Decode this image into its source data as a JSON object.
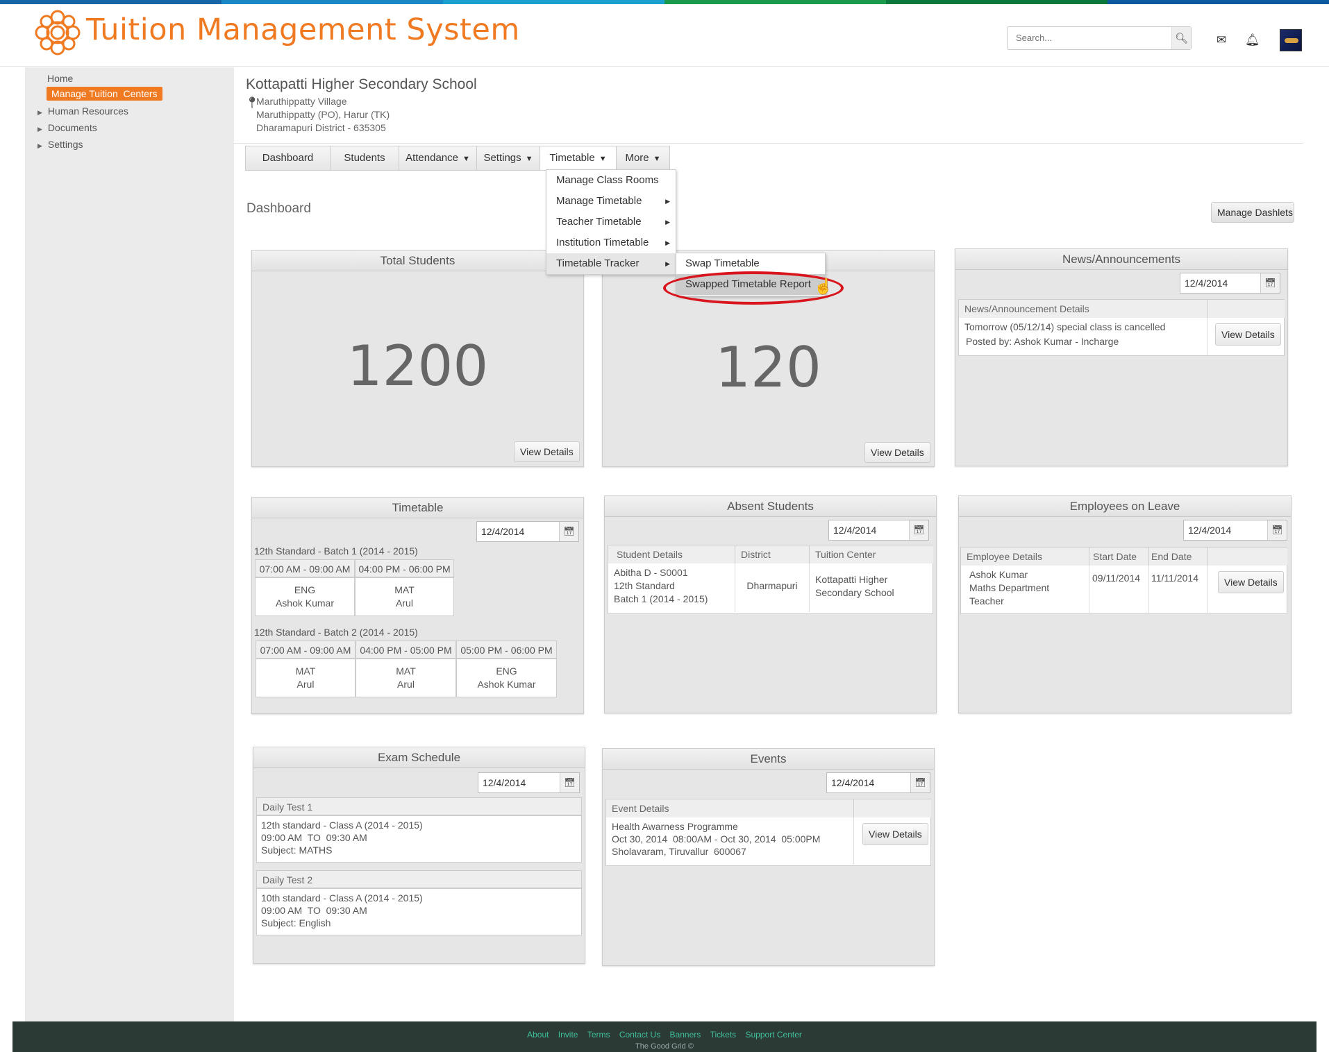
{
  "app": {
    "title": "Tuition Management System"
  },
  "header": {
    "search_placeholder": "Search...",
    "colors": [
      "#1565a8",
      "#1a87c7",
      "#1ba1d1",
      "#1b9a4b",
      "#0a7a3c",
      "#0e5aa0"
    ]
  },
  "sidebar": {
    "items": [
      {
        "label": "Home",
        "active": false,
        "expandable": false
      },
      {
        "label": "Manage Tuition  Centers",
        "active": true,
        "expandable": false
      },
      {
        "label": "Human Resources",
        "active": false,
        "expandable": true
      },
      {
        "label": "Documents",
        "active": false,
        "expandable": true
      },
      {
        "label": "Settings",
        "active": false,
        "expandable": true
      }
    ]
  },
  "school": {
    "name": "Kottapatti Higher Secondary School",
    "address": [
      "Maruthippatty Village",
      "Maruthippatty (PO), Harur (TK)",
      "Dharamapuri District - 635305"
    ]
  },
  "tabs": [
    "Dashboard",
    "Students",
    "Attendance",
    "Settings",
    "Timetable",
    "More"
  ],
  "timetable_menu": {
    "items": [
      "Manage Class Rooms",
      "Manage Timetable",
      "Teacher Timetable",
      "Institution Timetable",
      "Timetable Tracker"
    ],
    "submenu": [
      "Swap Timetable",
      "Swapped Timetable Report"
    ]
  },
  "dashboard": {
    "label": "Dashboard",
    "manage_dashlets": "Manage Dashlets",
    "total_students": {
      "title": "Total Students",
      "value": "1200",
      "button": "View Details"
    },
    "second_stat": {
      "value": "120",
      "button": "View Details"
    },
    "news": {
      "title": "News/Announcements",
      "date": "12/4/2014",
      "header": "News/Announcement Details",
      "text": "Tomorrow (05/12/14) special class is cancelled",
      "posted": "Posted by: Ashok Kumar - Incharge",
      "button": "View Details"
    },
    "timetable": {
      "title": "Timetable",
      "date": "12/4/2014",
      "batch1": {
        "label": "12th Standard - Batch 1 (2014 - 2015)",
        "slots": [
          "07:00 AM - 09:00 AM",
          "04:00 PM - 06:00 PM"
        ],
        "subjects": [
          [
            "ENG",
            "Ashok Kumar"
          ],
          [
            "MAT",
            "Arul"
          ]
        ]
      },
      "batch2": {
        "label": "12th Standard - Batch 2 (2014 - 2015)",
        "slots": [
          "07:00 AM - 09:00 AM",
          "04:00 PM - 05:00 PM",
          "05:00 PM - 06:00 PM"
        ],
        "subjects": [
          [
            "MAT",
            "Arul"
          ],
          [
            "MAT",
            "Arul"
          ],
          [
            "ENG",
            "Ashok Kumar"
          ]
        ]
      }
    },
    "absent": {
      "title": "Absent Students",
      "date": "12/4/2014",
      "headers": [
        "Student Details",
        "District",
        "Tuition Center"
      ],
      "row": {
        "student": [
          "Abitha D - S0001",
          "12th Standard",
          "Batch 1 (2014 - 2015)"
        ],
        "district": "Dharmapuri",
        "center": [
          "Kottapatti Higher",
          "Secondary School"
        ]
      }
    },
    "leave": {
      "title": "Employees on Leave",
      "date": "12/4/2014",
      "headers": [
        "Employee Details",
        "Start Date",
        "End Date"
      ],
      "row": {
        "employee": [
          "Ashok Kumar",
          "Maths Department",
          "Teacher"
        ],
        "start": "09/11/2014",
        "end": "11/11/2014"
      },
      "button": "View Details"
    },
    "exam": {
      "title": "Exam Schedule",
      "date": "12/4/2014",
      "tests": [
        {
          "name": "Daily Test 1",
          "lines": [
            "12th standard - Class A (2014 - 2015)",
            "09:00 AM  TO  09:30 AM",
            "Subject: MATHS"
          ]
        },
        {
          "name": "Daily Test 2",
          "lines": [
            "10th standard - Class A (2014 - 2015)",
            "09:00 AM  TO  09:30 AM",
            "Subject: English"
          ]
        }
      ]
    },
    "events": {
      "title": "Events",
      "date": "12/4/2014",
      "header": "Event Details",
      "lines": [
        "Health Awarness Programme",
        "Oct 30, 2014  08:00AM - Oct 30, 2014  05:00PM",
        "Sholavaram, Tiruvallur  600067"
      ],
      "button": "View Details"
    }
  },
  "footer": {
    "links": [
      "About",
      "Invite",
      "Terms",
      "Contact Us",
      "Banners",
      "Tickets",
      "Support Center"
    ],
    "copyright": "The Good Grid ©"
  }
}
